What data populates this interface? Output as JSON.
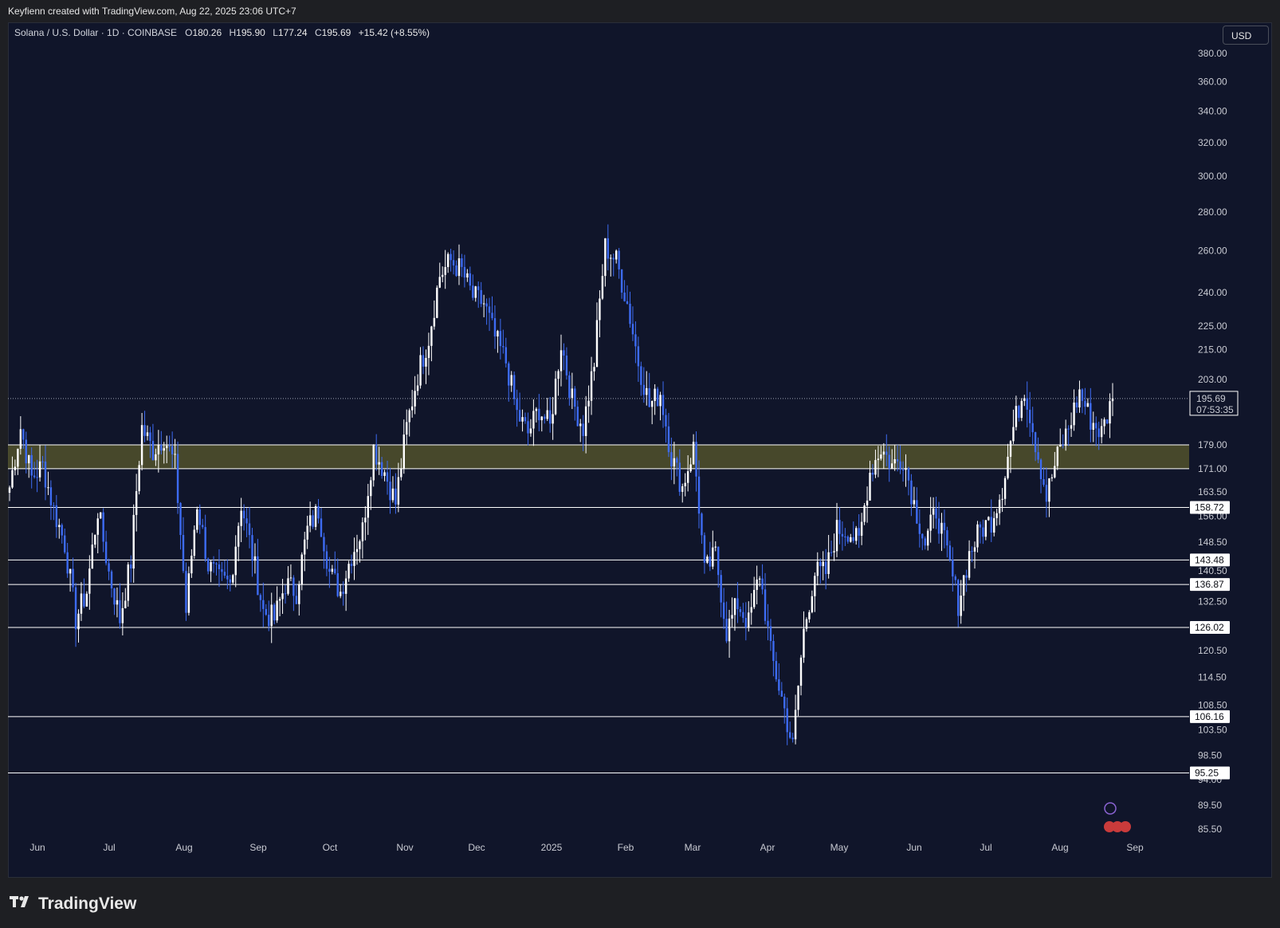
{
  "header": {
    "attribution": "Keyfienn created with TradingView.com, Aug 22, 2025 23:06 UTC+7"
  },
  "legend": {
    "symbol": "Solana / U.S. Dollar · 1D · COINBASE",
    "open_label": "O",
    "open": "180.26",
    "high_label": "H",
    "high": "195.90",
    "low_label": "L",
    "low": "177.24",
    "close_label": "C",
    "close": "195.69",
    "change": "+15.42 (+8.55%)"
  },
  "currency": "USD",
  "brand": {
    "name": "TradingView"
  },
  "colors": {
    "background": "#10152a",
    "up_candle": "#ffffff",
    "down_candle": "#3d6bf2",
    "zone": "#5a5a2c",
    "level_line": "#ffffff"
  },
  "chart_data": {
    "type": "candlestick",
    "symbol": "SOL/USD",
    "timeframe": "1D",
    "scale": "log",
    "ylim": [
      82,
      400
    ],
    "y_ticks": [
      "380.00",
      "360.00",
      "340.00",
      "320.00",
      "300.00",
      "280.00",
      "260.00",
      "240.00",
      "225.00",
      "215.00",
      "203.00",
      "179.00",
      "171.00",
      "163.50",
      "156.00",
      "148.50",
      "140.50",
      "132.50",
      "120.50",
      "114.50",
      "108.50",
      "103.50",
      "98.50",
      "94.00",
      "89.50",
      "85.50"
    ],
    "x_ticks": [
      "Jun",
      "Jul",
      "Aug",
      "Sep",
      "Oct",
      "Nov",
      "Dec",
      "2025",
      "Feb",
      "Mar",
      "Apr",
      "May",
      "Jun",
      "Jul",
      "Aug",
      "Sep"
    ],
    "last_price": {
      "value": 195.69,
      "label": "195.69",
      "countdown": "07:53:35"
    },
    "support_zone": {
      "low": 171.0,
      "high": 179.0
    },
    "levels": [
      {
        "value": 158.72,
        "label": "158.72"
      },
      {
        "value": 143.48,
        "label": "143.48"
      },
      {
        "value": 136.87,
        "label": "136.87"
      },
      {
        "value": 126.02,
        "label": "126.02"
      },
      {
        "value": 106.16,
        "label": "106.16"
      },
      {
        "value": 95.25,
        "label": "95.25"
      }
    ],
    "anchors": [
      [
        "Jun",
        165
      ],
      [
        "",
        185
      ],
      [
        "",
        168
      ],
      [
        "",
        172
      ],
      [
        "",
        158
      ],
      [
        "",
        148
      ],
      [
        "",
        128
      ],
      [
        "",
        135
      ],
      [
        "Jul",
        158
      ],
      [
        "",
        140
      ],
      [
        "",
        128
      ],
      [
        "",
        143
      ],
      [
        "",
        185
      ],
      [
        "",
        177
      ],
      [
        "Aug",
        182
      ],
      [
        "",
        172
      ],
      [
        "",
        130
      ],
      [
        "",
        160
      ],
      [
        "",
        142
      ],
      [
        "",
        138
      ],
      [
        "",
        137
      ],
      [
        "Sep",
        160
      ],
      [
        "",
        145
      ],
      [
        "",
        130
      ],
      [
        "",
        128
      ],
      [
        "",
        137
      ],
      [
        "",
        135
      ],
      [
        "",
        152
      ],
      [
        "Oct",
        158
      ],
      [
        "",
        140
      ],
      [
        "",
        135
      ],
      [
        "",
        145
      ],
      [
        "",
        152
      ],
      [
        "",
        178
      ],
      [
        "",
        170
      ],
      [
        "Nov",
        160
      ],
      [
        "",
        185
      ],
      [
        "",
        205
      ],
      [
        "",
        220
      ],
      [
        "",
        248
      ],
      [
        "",
        255
      ],
      [
        "",
        250
      ],
      [
        "Dec",
        238
      ],
      [
        "",
        235
      ],
      [
        "",
        220
      ],
      [
        "",
        210
      ],
      [
        "",
        190
      ],
      [
        "",
        183
      ],
      [
        "",
        192
      ],
      [
        "",
        185
      ],
      [
        "2025",
        218
      ],
      [
        "",
        195
      ],
      [
        "",
        185
      ],
      [
        "",
        210
      ],
      [
        "",
        262
      ],
      [
        "",
        255
      ],
      [
        "",
        235
      ],
      [
        "Feb",
        210
      ],
      [
        "",
        193
      ],
      [
        "",
        198
      ],
      [
        "",
        175
      ],
      [
        "",
        165
      ],
      [
        "",
        178
      ],
      [
        "Mar",
        140
      ],
      [
        "",
        145
      ],
      [
        "",
        125
      ],
      [
        "",
        132
      ],
      [
        "",
        127
      ],
      [
        "",
        140
      ],
      [
        "Apr",
        120
      ],
      [
        "",
        110
      ],
      [
        "",
        100
      ],
      [
        "",
        125
      ],
      [
        "",
        140
      ],
      [
        "",
        140
      ],
      [
        "",
        152
      ],
      [
        "May",
        152
      ],
      [
        "",
        148
      ],
      [
        "",
        170
      ],
      [
        "",
        178
      ],
      [
        "",
        172
      ],
      [
        "",
        175
      ],
      [
        "Jun",
        160
      ],
      [
        "",
        148
      ],
      [
        "",
        158
      ],
      [
        "",
        145
      ],
      [
        "",
        132
      ],
      [
        "",
        145
      ],
      [
        "Jul",
        152
      ],
      [
        "",
        155
      ],
      [
        "",
        165
      ],
      [
        "",
        185
      ],
      [
        "",
        200
      ],
      [
        "",
        180
      ],
      [
        "Aug",
        162
      ],
      [
        "",
        175
      ],
      [
        "",
        185
      ],
      [
        "",
        198
      ],
      [
        "",
        188
      ],
      [
        "",
        183
      ],
      [
        "",
        195.69
      ]
    ]
  }
}
